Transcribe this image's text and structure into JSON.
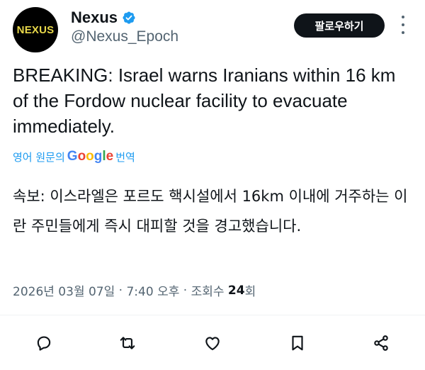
{
  "author": {
    "avatar_text": "NEXUS",
    "name": "Nexus",
    "handle": "@Nexus_Epoch",
    "verified_color": "#1d9bf0"
  },
  "follow_button": {
    "label": "팔로우하기"
  },
  "tweet": {
    "text": "BREAKING: Israel warns Iranians within 16 km of the Fordow nuclear facility to evacuate immediately.",
    "translate": {
      "prefix": "영어 원문의",
      "google": [
        "G",
        "o",
        "o",
        "g",
        "l",
        "e"
      ],
      "suffix": "번역"
    },
    "translated_text": "속보: 이스라엘은 포르도 핵시설에서 16km 이내에 거주하는 이란 주민들에게 즉시 대피할 것을 경고했습니다."
  },
  "meta": {
    "date": "2026년 03월 07일",
    "sep1": "·",
    "time": "7:40 오후",
    "sep2": "·",
    "views_label": "조회수",
    "views_count": "24",
    "views_unit": "회"
  },
  "actions": [
    "reply-icon",
    "retweet-icon",
    "like-icon",
    "bookmark-icon",
    "share-icon"
  ],
  "colors": {
    "text": "#0f1419",
    "secondary": "#536471",
    "accent": "#1d9bf0",
    "avatar_text": "#e9d94a"
  }
}
